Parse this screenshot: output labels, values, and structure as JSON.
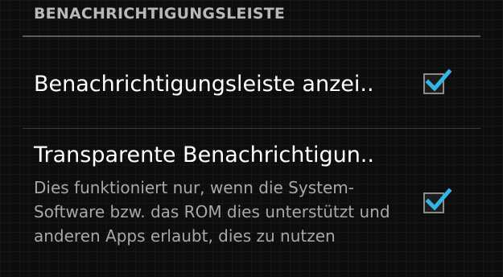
{
  "section": {
    "title": "BENACHRICHTIGUNGSLEISTE"
  },
  "preferences": [
    {
      "title": "Benachrichtigungsleiste anzei..",
      "summary": "",
      "checked": true
    },
    {
      "title": "Transparente Benachrichtigun..",
      "summary": "Dies funktioniert nur, wenn die System-Software bzw. das ROM dies unterstützt und anderen Apps erlaubt, dies zu nutzen",
      "checked": true
    }
  ],
  "colors": {
    "accent": "#33b5e5",
    "header_text": "#b8b8b8",
    "summary_text": "#a8a8a8"
  }
}
